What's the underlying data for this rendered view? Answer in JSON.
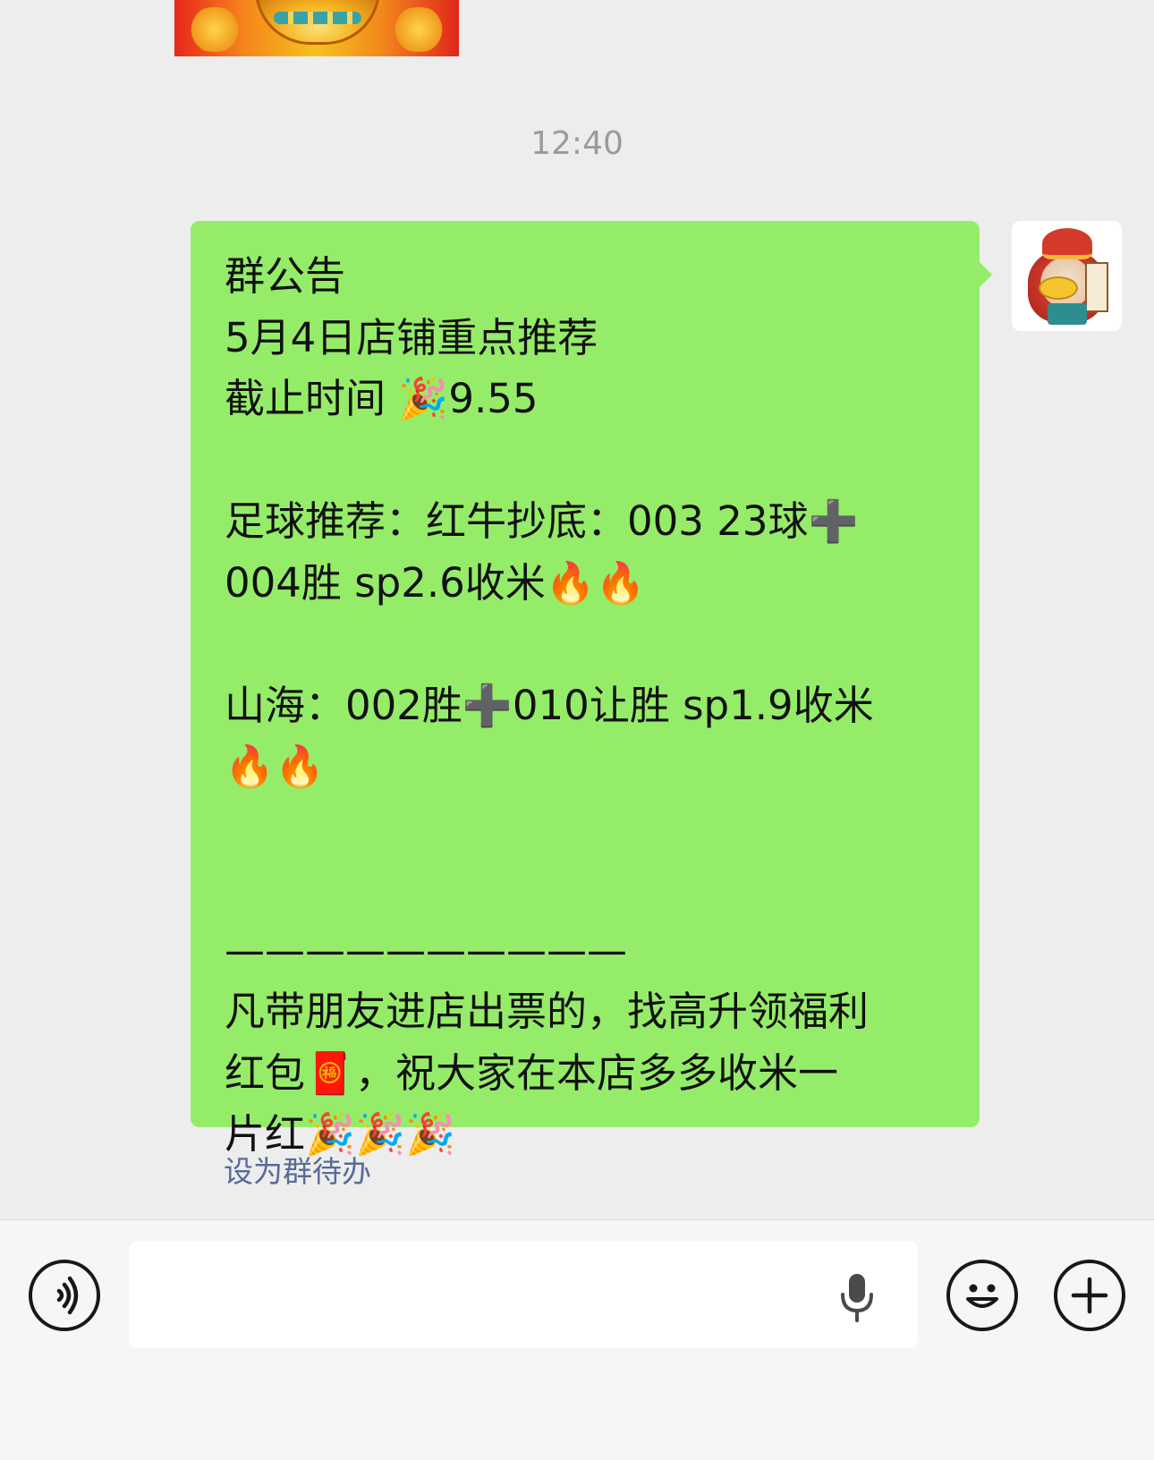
{
  "chat": {
    "timestamp": "12:40",
    "message": {
      "lines": [
        "群公告",
        "5月4日店铺重点推荐",
        "截止时间 🎉9.55",
        "",
        "足球推荐：红牛抄底：003 23球➕",
        "004胜 sp2.6收米🔥🔥",
        "",
        "山海：002胜➕010让胜 sp1.9收米",
        "🔥🔥",
        "",
        "",
        "——————————",
        "凡带朋友进店出票的，找高升领福利",
        "红包🧧，祝大家在本店多多收米一",
        "片红🎉🎉🎉"
      ]
    },
    "set_todo_label": "设为群待办"
  },
  "colors": {
    "bubble": "#95ec69",
    "background": "#ededed",
    "link": "#576b95",
    "timestamp": "#9b9b9b"
  },
  "input_bar": {
    "icons": [
      "voice-icon",
      "microphone-icon",
      "emoji-icon",
      "plus-icon"
    ]
  }
}
